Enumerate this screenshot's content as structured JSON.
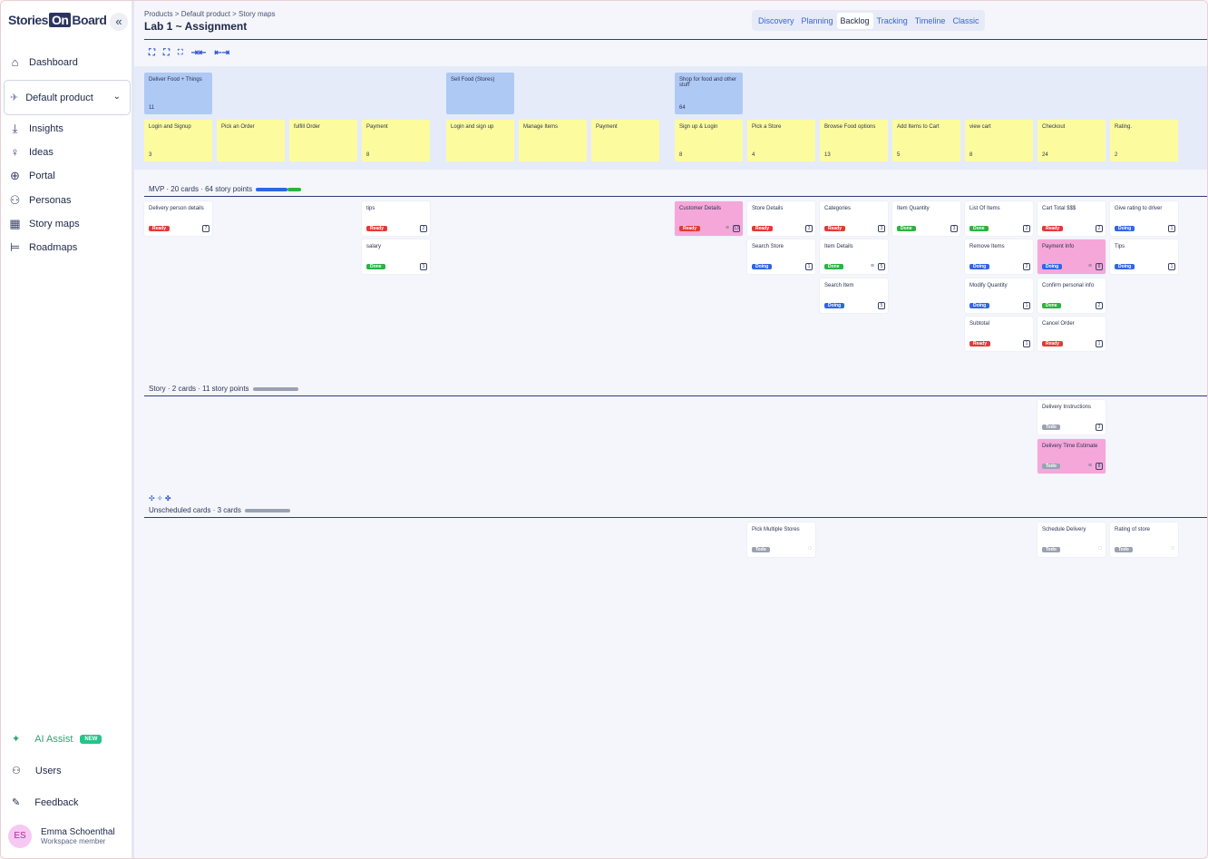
{
  "app": {
    "logo_left": "Stories",
    "logo_on": "On",
    "logo_right": "Board"
  },
  "sidebar": {
    "items": [
      {
        "label": "Dashboard",
        "icon": "home-icon"
      },
      {
        "label": "Insights",
        "icon": "download-icon"
      },
      {
        "label": "Ideas",
        "icon": "lightbulb-icon"
      },
      {
        "label": "Portal",
        "icon": "globe-icon"
      },
      {
        "label": "Personas",
        "icon": "person-icon"
      },
      {
        "label": "Story maps",
        "icon": "storymap-icon"
      },
      {
        "label": "Roadmaps",
        "icon": "roadmap-icon"
      }
    ],
    "product": "Default product",
    "ai_label": "AI Assist",
    "ai_badge": "NEW",
    "users": "Users",
    "feedback": "Feedback",
    "user_initials": "ES",
    "user_name": "Emma Schoenthal",
    "user_role": "Workspace member"
  },
  "header": {
    "breadcrumb": "Products > Default product > Story maps",
    "title": "Lab 1 ~ Assignment",
    "tabs": [
      "Discovery",
      "Planning",
      "Backlog",
      "Tracking",
      "Timeline",
      "Classic"
    ],
    "active_tab": "Backlog"
  },
  "toolbar": [
    "[ ]",
    "[ ]",
    "[ ]",
    "→|←",
    "←|→"
  ],
  "activities": [
    {
      "title": "Deliver Food + Things",
      "count": "11"
    },
    {
      "title": "Sell Food (Stores)",
      "count": ""
    },
    {
      "title": "Shop for food and other stuff",
      "count": "64"
    }
  ],
  "tasks": [
    {
      "title": "Login and Signup",
      "count": "3"
    },
    {
      "title": "Pick an Order",
      "count": ""
    },
    {
      "title": "fulfill Order",
      "count": ""
    },
    {
      "title": "Payment",
      "count": "8"
    },
    {
      "title": "Login and sign up",
      "count": ""
    },
    {
      "title": "Manage Items",
      "count": ""
    },
    {
      "title": "Payment",
      "count": ""
    },
    {
      "title": "Sign up & Login",
      "count": "8"
    },
    {
      "title": "Pick a Store",
      "count": "4"
    },
    {
      "title": "Browse Food options",
      "count": "13"
    },
    {
      "title": "Add Items to Cart",
      "count": "5"
    },
    {
      "title": "view cart",
      "count": "8"
    },
    {
      "title": "Checkout",
      "count": "24"
    },
    {
      "title": "Rating.",
      "count": "2"
    }
  ],
  "releases": [
    {
      "label": "MVP · 20 cards · 64 story points"
    },
    {
      "label": "Story · 2 cards · 11 story points"
    },
    {
      "label": "Unscheduled cards · 3 cards"
    }
  ],
  "unscheduled_tools": "✣ ✧ ✤",
  "stories": [
    {
      "title": "Delivery person details",
      "status": "Ready",
      "cls": "ready",
      "cb": "7"
    },
    {
      "title": "tips",
      "status": "Ready",
      "cls": "ready",
      "cb": "2"
    },
    {
      "title": "salary",
      "status": "Done",
      "cls": "done",
      "cb": "3"
    },
    {
      "title": "Customer Details",
      "status": "Ready",
      "cls": "ready",
      "cb": "13"
    },
    {
      "title": "Store Details",
      "status": "Ready",
      "cls": "ready",
      "cb": "3"
    },
    {
      "title": "Search Store",
      "status": "Doing",
      "cls": "doing",
      "cb": "1"
    },
    {
      "title": "Categories",
      "status": "Ready",
      "cls": "ready",
      "cb": "3"
    },
    {
      "title": "Item Details",
      "status": "Done",
      "cls": "done",
      "cb": "5"
    },
    {
      "title": "Search Item",
      "status": "Doing",
      "cls": "doing",
      "cb": "5"
    },
    {
      "title": "Item Quantity",
      "status": "Done",
      "cls": "done",
      "cb": "3"
    },
    {
      "title": "List Of Items",
      "status": "Done",
      "cls": "done",
      "cb": "2"
    },
    {
      "title": "Remove Items",
      "status": "Doing",
      "cls": "doing",
      "cb": "2"
    },
    {
      "title": "Modify Quantity",
      "status": "Doing",
      "cls": "doing",
      "cb": "1"
    },
    {
      "title": "Subtotal",
      "status": "Ready",
      "cls": "ready",
      "cb": "1"
    },
    {
      "title": "Cart Total $$$",
      "status": "Ready",
      "cls": "ready",
      "cb": "2"
    },
    {
      "title": "Payment Info",
      "status": "Doing",
      "cls": "doing",
      "cb": "8"
    },
    {
      "title": "Confirm personal info",
      "status": "Done",
      "cls": "done",
      "cb": "2"
    },
    {
      "title": "Cancel Order",
      "status": "Ready",
      "cls": "ready",
      "cb": "1"
    },
    {
      "title": "Give rating to driver",
      "status": "Doing",
      "cls": "doing",
      "cb": "1"
    },
    {
      "title": "Tips",
      "status": "Doing",
      "cls": "doing",
      "cb": "1"
    },
    {
      "title": "Delivery Instructions",
      "status": "Todo",
      "cls": "todo",
      "cb": "3"
    },
    {
      "title": "Delivery Time Estimate",
      "status": "Todo",
      "cls": "todo",
      "cb": "8"
    },
    {
      "title": "Pick Multiple Stores",
      "status": "Todo",
      "cls": "todo",
      "cb": ""
    },
    {
      "title": "Schedule Delivery",
      "status": "Todo",
      "cls": "todo",
      "cb": ""
    },
    {
      "title": "Rating of store",
      "status": "Todo",
      "cls": "todo",
      "cb": ""
    }
  ]
}
